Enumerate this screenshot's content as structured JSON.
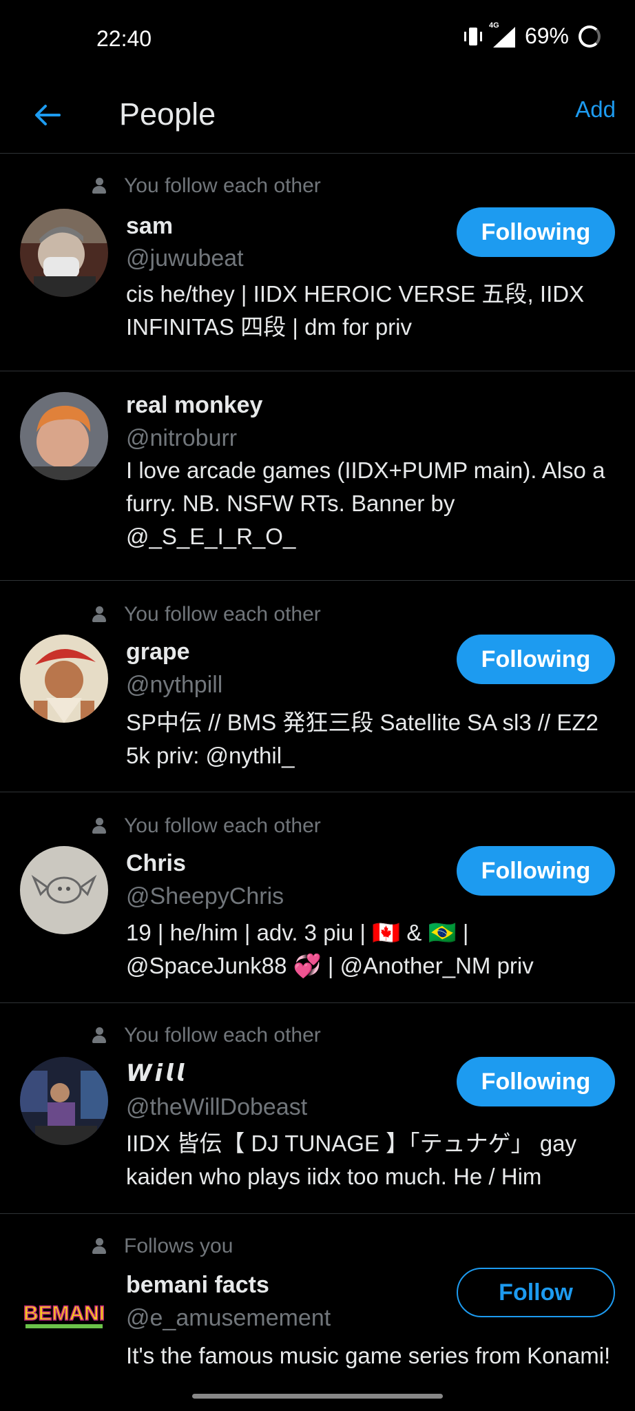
{
  "status_bar": {
    "time": "22:40",
    "network": "4G",
    "battery": "69%"
  },
  "header": {
    "title": "People",
    "add_label": "Add"
  },
  "people": [
    {
      "social": "You follow each other",
      "name": "sam",
      "handle": "@juwubeat",
      "bio": "cis he/they | IIDX HEROIC VERSE 五段, IIDX INFINITAS 四段 | dm for priv",
      "button": "Following"
    },
    {
      "social": "",
      "name": "real monkey",
      "handle": "@nitroburr",
      "bio": "I love arcade games (IIDX+PUMP main). Also a furry. NB. NSFW RTs. Banner by @_S_E_I_R_O_",
      "button": ""
    },
    {
      "social": "You follow each other",
      "name": "grape",
      "handle": "@nythpill",
      "bio": "SP中伝 // BMS 発狂三段 Satellite SA sl3 // EZ2 5k     priv: @nythil_",
      "button": "Following"
    },
    {
      "social": "You follow each other",
      "name": "Chris",
      "handle": "@SheepyChris",
      "bio": "19 | he/him | adv. 3 piu | 🇨🇦 & 🇧🇷 | @SpaceJunk88 💞 | @Another_NM priv",
      "button": "Following"
    },
    {
      "social": "You follow each other",
      "name": "𝙒𝙞𝙡𝙡",
      "handle": "@theWillDobeast",
      "bio": "IIDX 皆伝【 DJ TUNAGE 】「テュナゲ」 gay kaiden who plays iidx too much. He / Him",
      "button": "Following"
    },
    {
      "social": "Follows you",
      "name": "bemani facts",
      "handle": "@e_amusemement",
      "bio": "It's the famous music game series from Konami!",
      "button": "Follow"
    }
  ],
  "avatar_logo": "BEMANI"
}
